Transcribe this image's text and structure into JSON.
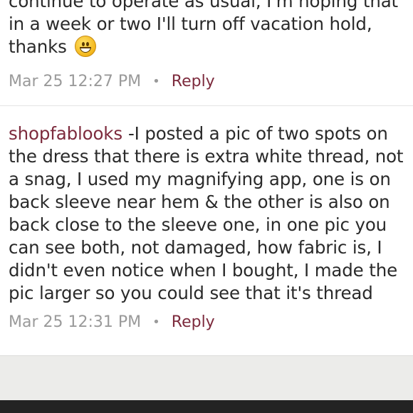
{
  "comments": [
    {
      "user": "",
      "text": "continue to operate as usual, I'm hoping that in a week or two I'll turn off vacation hold, thanks",
      "emoji": "grinning-face",
      "timestamp": "Mar 25 12:27 PM",
      "reply_label": "Reply"
    },
    {
      "user": "shopfablooks",
      "text": "-I posted a pic of two spots on the dress that there is extra white thread, not a snag, I used my magnifying app, one is on back sleeve near hem & the other is also on back close to the sleeve one, in one pic you can see both, not damaged, how fabric is, I didn't even notice when I bought, I made the pic larger so you could see that it's thread",
      "timestamp": "Mar 25 12:31 PM",
      "reply_label": "Reply"
    }
  ],
  "separator": "•",
  "colors": {
    "accent": "#7d2b3d",
    "muted": "#9a9a9a",
    "footer_bg": "#ececea",
    "bottom_bar": "#232323"
  }
}
